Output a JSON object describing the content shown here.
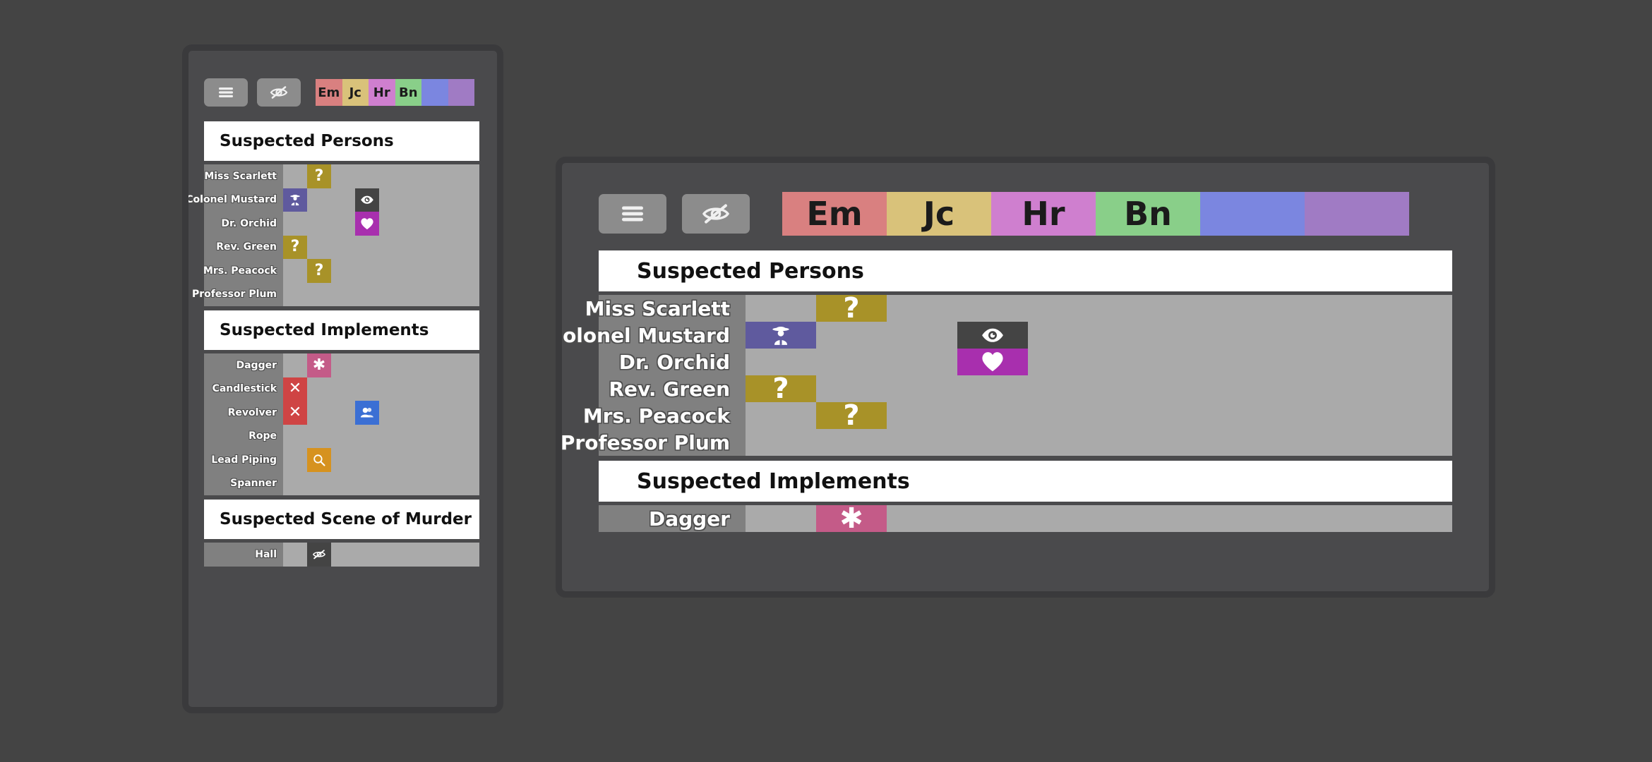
{
  "app": {
    "background_color": "#444444",
    "panel_frame_color": "#3a3a3c",
    "panel_body_color": "#4a4a4c"
  },
  "toolbar": {
    "menu_button_label": "menu",
    "hide_button_label": "hide",
    "button_color": "#8c8c8c",
    "icon_color": "#ffffff"
  },
  "player_tabs": [
    {
      "label": "Em",
      "color": "#d98080"
    },
    {
      "label": "Jc",
      "color": "#d9c27a"
    },
    {
      "label": "Hr",
      "color": "#cf7fcf"
    },
    {
      "label": "Bn",
      "color": "#89cf89"
    },
    {
      "label": "",
      "color": "#7b86e0"
    },
    {
      "label": "",
      "color": "#a07bc4"
    }
  ],
  "sections": [
    {
      "title": "Suspected Persons",
      "rows": [
        {
          "label": "Miss Scarlett",
          "cells": [
            {
              "col": 1,
              "type": "question",
              "color": "#a89228",
              "glyph": "?"
            }
          ]
        },
        {
          "label": "Colonel Mustard",
          "cells": [
            {
              "col": 0,
              "type": "detective",
              "color": "#5f5a9e",
              "glyph": "detective-icon"
            },
            {
              "col": 3,
              "type": "eye",
              "color": "#444444",
              "glyph": "eye-icon"
            }
          ]
        },
        {
          "label": "Dr. Orchid",
          "cells": [
            {
              "col": 3,
              "type": "heart",
              "color": "#a82fae",
              "glyph": "heart-icon"
            }
          ]
        },
        {
          "label": "Rev. Green",
          "cells": [
            {
              "col": 0,
              "type": "question",
              "color": "#a89228",
              "glyph": "?"
            }
          ]
        },
        {
          "label": "Mrs. Peacock",
          "cells": [
            {
              "col": 1,
              "type": "question",
              "color": "#a89228",
              "glyph": "?"
            }
          ]
        },
        {
          "label": "Professor Plum",
          "cells": []
        }
      ]
    },
    {
      "title": "Suspected Implements",
      "rows": [
        {
          "label": "Dagger",
          "cells": [
            {
              "col": 1,
              "type": "asterisk",
              "color": "#c45b88",
              "glyph": "✱"
            }
          ]
        },
        {
          "label": "Candlestick",
          "cells": [
            {
              "col": 0,
              "type": "cross",
              "color": "#cf4444",
              "glyph": "✕"
            }
          ]
        },
        {
          "label": "Revolver",
          "cells": [
            {
              "col": 0,
              "type": "cross",
              "color": "#cf4444",
              "glyph": "✕"
            },
            {
              "col": 3,
              "type": "people",
              "color": "#3b6fd4",
              "glyph": "people-icon"
            }
          ]
        },
        {
          "label": "Rope",
          "cells": []
        },
        {
          "label": "Lead Piping",
          "cells": [
            {
              "col": 1,
              "type": "search",
              "color": "#d6921f",
              "glyph": "search-icon"
            }
          ]
        },
        {
          "label": "Spanner",
          "cells": []
        }
      ]
    },
    {
      "title": "Suspected Scene of Murder",
      "rows": [
        {
          "label": "Hall",
          "cells": [
            {
              "col": 1,
              "type": "eye-slash",
              "color": "#444444",
              "glyph": "eye-slash-icon"
            }
          ]
        }
      ]
    }
  ],
  "large_panel": {
    "visible_sections": [
      {
        "title": "Suspected Persons",
        "row_count": 6
      },
      {
        "title": "Suspected Implements",
        "row_count": 1
      }
    ]
  },
  "grid_colors": {
    "label_column": "#808080",
    "cell_area": "#aaaaaa",
    "row_label_text": "#ffffff"
  }
}
